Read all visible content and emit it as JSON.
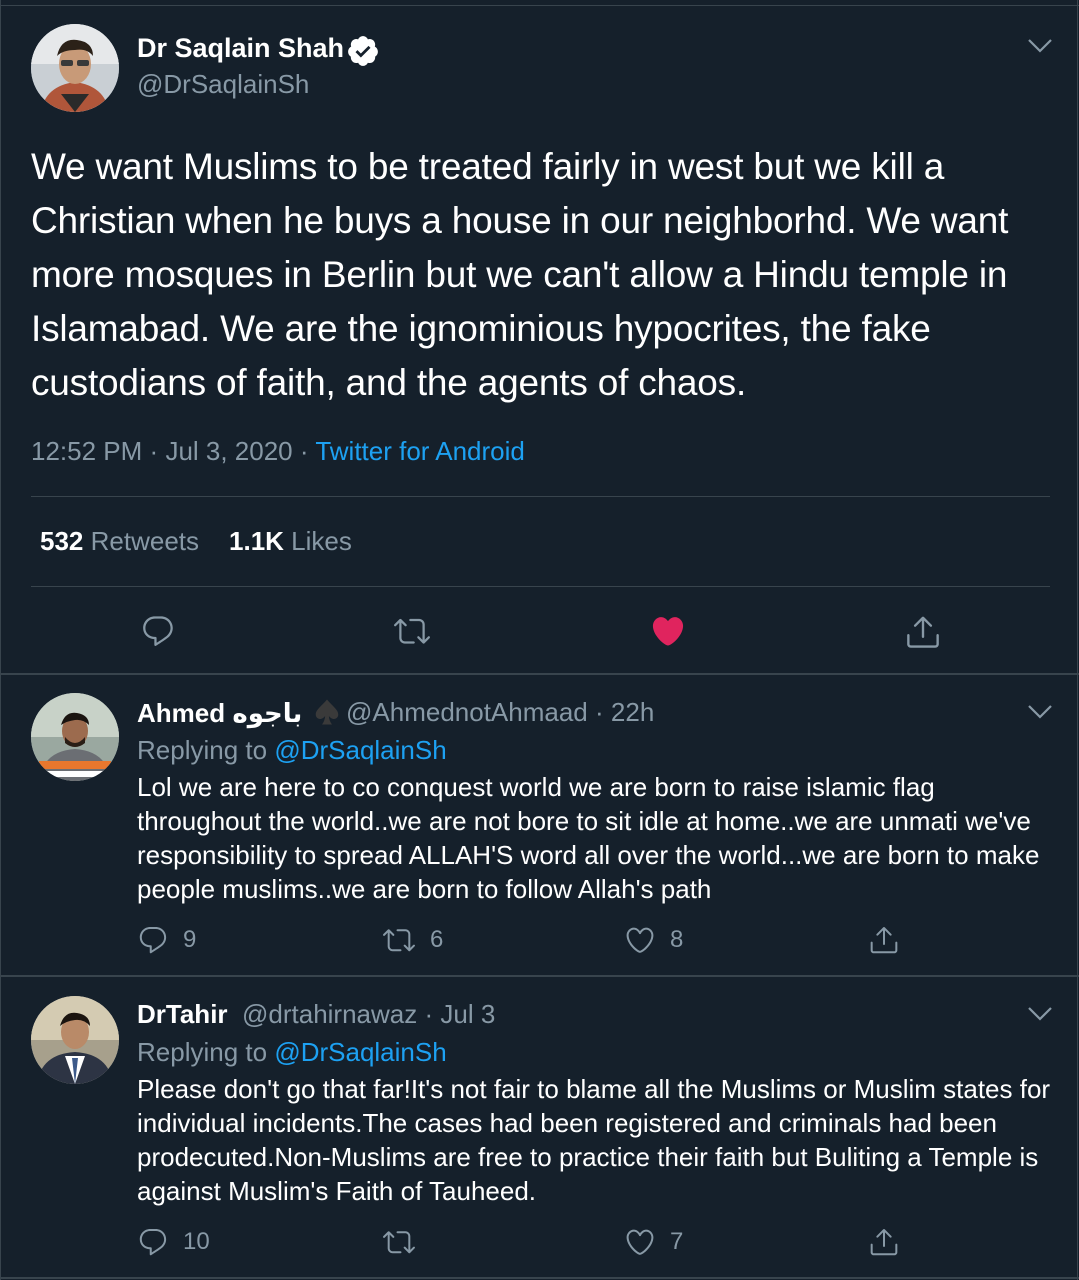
{
  "main_tweet": {
    "author_name": "Dr Saqlain Shah",
    "author_handle": "@DrSaqlainSh",
    "text": "We want Muslims to be treated fairly  in west but we kill a Christian when he buys a house in our neighborhd. We want more mosques in Berlin but we can't allow a Hindu temple in Islamabad. We are the ignominious hypocrites, the fake custodians of faith, and the agents of chaos.",
    "time": "12:52 PM",
    "date": "Jul 3, 2020",
    "separator": "·",
    "source": "Twitter for Android",
    "retweets_count": "532",
    "retweets_label": "Retweets",
    "likes_count": "1.1K",
    "likes_label": "Likes",
    "liked": true
  },
  "replies": [
    {
      "author_name": "Ahmed باجوه",
      "author_handle": "@AhmednotAhmaad",
      "time": "22h",
      "replying_label": "Replying to",
      "replying_to": "@DrSaqlainSh",
      "text": "Lol we are here to co conquest world we are born to raise islamic flag throughout the world..we are not bore to sit idle at home..we are unmati we've responsibility to spread ALLAH'S word all over the world...we are born to make people muslims..we are born to follow Allah's path",
      "reply_count": "9",
      "retweet_count": "6",
      "like_count": "8"
    },
    {
      "author_name": "DrTahir",
      "author_handle": "@drtahirnawaz",
      "time": "Jul 3",
      "replying_label": "Replying to",
      "replying_to": "@DrSaqlainSh",
      "text": "Please don't go that far!It's not fair to blame all the Muslims or Muslim states for individual incidents.The cases had been registered and criminals had been prodecuted.Non-Muslims are free to practice their faith but Buliting a Temple is against Muslim's Faith of Tauheed.",
      "reply_count": "10",
      "retweet_count": "",
      "like_count": "7"
    }
  ],
  "colors": {
    "background": "#15202b",
    "text_primary": "#ffffff",
    "text_secondary": "#8899a6",
    "accent_blue": "#1da1f2",
    "like_red": "#e0245e",
    "divider": "#38444d"
  },
  "icons": {
    "reply": "reply-icon",
    "retweet": "retweet-icon",
    "like": "heart-icon",
    "share": "share-icon",
    "verified": "verified-badge-icon",
    "menu": "chevron-down-icon"
  }
}
